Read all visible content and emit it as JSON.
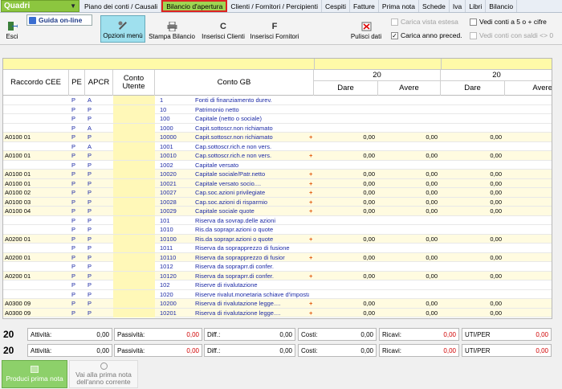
{
  "combo": {
    "value": "Quadri"
  },
  "tabs": [
    "Piano dei conti / Causali",
    "Bilancio d'apertura",
    "Clienti / Fornitori / Percipienti",
    "Cespiti",
    "Fatture",
    "Prima nota",
    "Schede",
    "Iva",
    "Libri",
    "Bilancio"
  ],
  "active_tab": "Bilancio d'apertura",
  "toolbar": {
    "esci": "Esci",
    "guida": "Guida on-line",
    "opzioni": "Opzioni menù",
    "stampa": "Stampa Bilancio",
    "ins_clienti": "Inserisci Clienti",
    "ins_fornitori": "Inserisci Fornitori",
    "pulisci": "Pulisci dati",
    "carica_vista": "Carica vista estesa",
    "carica_anno": "Carica anno preced.",
    "vedi_5": "Vedi conti a 5 o + cifre",
    "vedi_saldi": "Vedi conti con saldi <> 0"
  },
  "grid": {
    "headers": {
      "raccordo": "Raccordo CEE",
      "pe": "PE",
      "apcr": "APCR",
      "conto_utente": "Conto Utente",
      "conto_gb": "Conto GB",
      "year1": "20",
      "year2": "20",
      "dare": "Dare",
      "avere": "Avere",
      "dare2": "Dare",
      "avere2": "Avere"
    },
    "rows": [
      {
        "cee": "",
        "pe": "P",
        "apcr": "A",
        "code": "1",
        "desc": "Fonti di finanziamento durev.",
        "plus": false,
        "dare": "",
        "avere": "",
        "dare2": ""
      },
      {
        "cee": "",
        "pe": "P",
        "apcr": "P",
        "code": "10",
        "desc": "Patrimonio netto",
        "plus": false,
        "dare": "",
        "avere": "",
        "dare2": ""
      },
      {
        "cee": "",
        "pe": "P",
        "apcr": "P",
        "code": "100",
        "desc": "Capitale (netto o sociale)",
        "plus": false,
        "dare": "",
        "avere": "",
        "dare2": ""
      },
      {
        "cee": "",
        "pe": "P",
        "apcr": "A",
        "code": "1000",
        "desc": "Capit.sottoscr.non richiamato",
        "plus": false,
        "dare": "",
        "avere": "",
        "dare2": ""
      },
      {
        "cee": "A0100 01",
        "pe": "P",
        "apcr": "P",
        "code": "10000",
        "desc": "Capit.sottoscr.non richiamato",
        "plus": true,
        "dare": "0,00",
        "avere": "0,00",
        "dare2": "0,00"
      },
      {
        "cee": "",
        "pe": "P",
        "apcr": "A",
        "code": "1001",
        "desc": "Cap.sottoscr.rich.e non vers.",
        "plus": false,
        "dare": "",
        "avere": "",
        "dare2": ""
      },
      {
        "cee": "A0100 01",
        "pe": "P",
        "apcr": "P",
        "code": "10010",
        "desc": "Cap.sottoscr.rich.e non vers.",
        "plus": true,
        "dare": "0,00",
        "avere": "0,00",
        "dare2": "0,00"
      },
      {
        "cee": "",
        "pe": "P",
        "apcr": "P",
        "code": "1002",
        "desc": "Capitale versato",
        "plus": false,
        "dare": "",
        "avere": "",
        "dare2": ""
      },
      {
        "cee": "A0100 01",
        "pe": "P",
        "apcr": "P",
        "code": "10020",
        "desc": "Capitale sociale/Patr.netto",
        "plus": true,
        "dare": "0,00",
        "avere": "0,00",
        "dare2": "0,00"
      },
      {
        "cee": "A0100 01",
        "pe": "P",
        "apcr": "P",
        "code": "10021",
        "desc": "Capitale versato socio....",
        "plus": true,
        "dare": "0,00",
        "avere": "0,00",
        "dare2": "0,00"
      },
      {
        "cee": "A0100 02",
        "pe": "P",
        "apcr": "P",
        "code": "10027",
        "desc": "Cap.soc.azioni privilegiate",
        "plus": true,
        "dare": "0,00",
        "avere": "0,00",
        "dare2": "0,00"
      },
      {
        "cee": "A0100 03",
        "pe": "P",
        "apcr": "P",
        "code": "10028",
        "desc": "Cap.soc.azioni di risparmio",
        "plus": true,
        "dare": "0,00",
        "avere": "0,00",
        "dare2": "0,00"
      },
      {
        "cee": "A0100 04",
        "pe": "P",
        "apcr": "P",
        "code": "10029",
        "desc": "Capitale sociale quote",
        "plus": true,
        "dare": "0,00",
        "avere": "0,00",
        "dare2": "0,00"
      },
      {
        "cee": "",
        "pe": "P",
        "apcr": "P",
        "code": "101",
        "desc": "Riserva da sovrap.delle azioni",
        "plus": false,
        "dare": "",
        "avere": "",
        "dare2": ""
      },
      {
        "cee": "",
        "pe": "P",
        "apcr": "P",
        "code": "1010",
        "desc": "Ris.da soprapr.azioni o quote",
        "plus": false,
        "dare": "",
        "avere": "",
        "dare2": ""
      },
      {
        "cee": "A0200 01",
        "pe": "P",
        "apcr": "P",
        "code": "10100",
        "desc": "Ris.da soprapr.azioni o quote",
        "plus": true,
        "dare": "0,00",
        "avere": "0,00",
        "dare2": "0,00"
      },
      {
        "cee": "",
        "pe": "P",
        "apcr": "P",
        "code": "1011",
        "desc": "Riserva da soprapprezzo di fusione",
        "plus": false,
        "dare": "",
        "avere": "",
        "dare2": ""
      },
      {
        "cee": "A0200 01",
        "pe": "P",
        "apcr": "P",
        "code": "10110",
        "desc": "Riserva da soprapprezzo di fusior",
        "plus": true,
        "dare": "0,00",
        "avere": "0,00",
        "dare2": "0,00"
      },
      {
        "cee": "",
        "pe": "P",
        "apcr": "P",
        "code": "1012",
        "desc": "Riserva da sopraprr.di confer.",
        "plus": false,
        "dare": "",
        "avere": "",
        "dare2": ""
      },
      {
        "cee": "A0200 01",
        "pe": "P",
        "apcr": "P",
        "code": "10120",
        "desc": "Riserva da sopraprr.di confer.",
        "plus": true,
        "dare": "0,00",
        "avere": "0,00",
        "dare2": "0,00"
      },
      {
        "cee": "",
        "pe": "P",
        "apcr": "P",
        "code": "102",
        "desc": "Riserve di rivalutazione",
        "plus": false,
        "dare": "",
        "avere": "",
        "dare2": ""
      },
      {
        "cee": "",
        "pe": "P",
        "apcr": "P",
        "code": "1020",
        "desc": "Riserve rivalut.monetaria schiave d'imposta",
        "plus": false,
        "dare": "",
        "avere": "",
        "dare2": ""
      },
      {
        "cee": "A0300 09",
        "pe": "P",
        "apcr": "P",
        "code": "10200",
        "desc": "Riserva di rivalutazione legge....",
        "plus": true,
        "dare": "0,00",
        "avere": "0,00",
        "dare2": "0,00"
      },
      {
        "cee": "A0300 09",
        "pe": "P",
        "apcr": "P",
        "code": "10201",
        "desc": "Riserva di rivalutazione legge....",
        "plus": true,
        "dare": "0,00",
        "avere": "0,00",
        "dare2": "0,00"
      }
    ]
  },
  "totals": [
    {
      "year": "20",
      "attivita": "0,00",
      "passivita": "0,00",
      "diff": "0,00",
      "costi": "0,00",
      "ricavi": "0,00",
      "uti": "0,00"
    },
    {
      "year": "20",
      "attivita": "0,00",
      "passivita": "0,00",
      "diff": "0,00",
      "costi": "0,00",
      "ricavi": "0,00",
      "uti": "0,00"
    }
  ],
  "totals_labels": {
    "attivita": "Attività:",
    "passivita": "Passività:",
    "diff": "Diff.:",
    "costi": "Costi:",
    "ricavi": "Ricavi:",
    "uti": "UTI/PER"
  },
  "bottom": {
    "produci": "Produci prima nota",
    "vai": "Vai alla prima nota dell'anno corrente"
  }
}
